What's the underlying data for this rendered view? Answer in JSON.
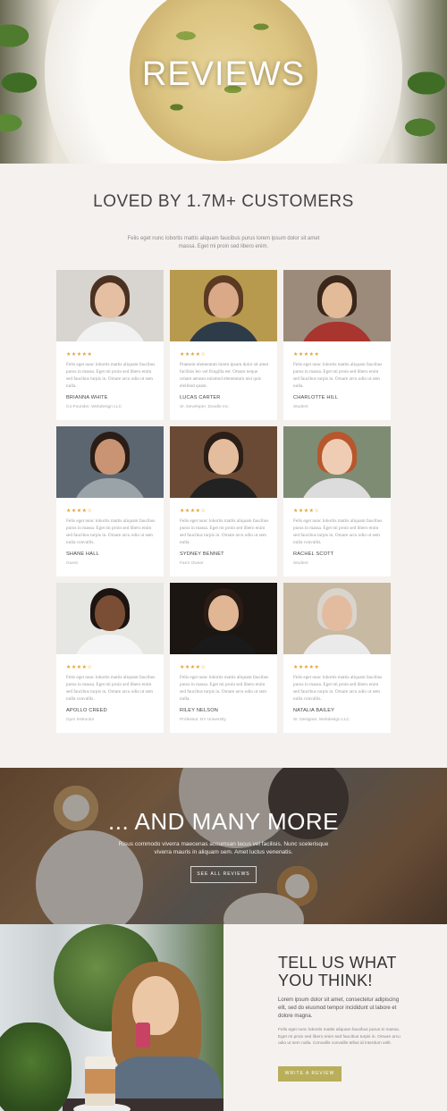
{
  "hero": {
    "title": "REVIEWS"
  },
  "intro": {
    "title": "LOVED BY 1.7M+ CUSTOMERS",
    "text": "Felis eget nunc lobortis mattis aliquam faucibus purus lorem ipsum dolor sit amet massa. Eget mi proin sed libero enim."
  },
  "reviews": [
    {
      "stars": "★★★★★",
      "quote": "Felis eget nunc lobortis mattis aliquam faucibus purus in massa. Eget mi proin sed libero enim sed faucibus turpis in. Ornare arcu odio ut sem nulla.",
      "name": "BRIANNA WHITE",
      "role": "Co-Founder, Webdesign LLC",
      "colors": {
        "bg": "#d8d4cf",
        "hair": "#4a3122",
        "skin": "#e5bfa2",
        "body": "#f1f1f1"
      }
    },
    {
      "stars": "★★★★☆",
      "quote": "Praesent elementum lorem ipsum dolor sit amet facilisis leo vel fringilla est. Ornare neque ornare aenean euismod elementum nisi quis eleifend quam.",
      "name": "LUCAS CARTER",
      "role": "Sr. Developer, Doodle Inc.",
      "colors": {
        "bg": "#b89a4e",
        "hair": "#5a3a22",
        "skin": "#d9a988",
        "body": "#2e3c4a"
      }
    },
    {
      "stars": "★★★★★",
      "quote": "Felis eget nunc lobortis mattis aliquam faucibus purus in massa. Eget mi proin sed libero enim sed faucibus turpis in. Ornare arcu odio ut sem nulla.",
      "name": "CHARLOTTE HILL",
      "role": "Student",
      "colors": {
        "bg": "#9c8b7a",
        "hair": "#3a261a",
        "skin": "#e3bb98",
        "body": "#a8352e"
      }
    },
    {
      "stars": "★★★★☆",
      "quote": "Felis eget nunc lobortis mattis aliquam faucibus purus in massa. Eget mi proin sed libero enim sed faucibus turpis in. Ornare arcu odio ut sem nulla convallis.",
      "name": "SHANE HALL",
      "role": "Guest",
      "colors": {
        "bg": "#5b6670",
        "hair": "#2a1d15",
        "skin": "#c89474",
        "body": "#9aa3a8"
      }
    },
    {
      "stars": "★★★★☆",
      "quote": "Felis eget nunc lobortis mattis aliquam faucibus purus in massa. Eget mi proin sed libero enim sed faucibus turpis in. Ornare arcu odio ut sem nulla.",
      "name": "SYDNEY BENNET",
      "role": "Farm Owner",
      "colors": {
        "bg": "#6a4a34",
        "hair": "#2b1e16",
        "skin": "#e4bd9e",
        "body": "#222222"
      }
    },
    {
      "stars": "★★★★☆",
      "quote": "Felis eget nunc lobortis mattis aliquam faucibus purus in massa. Eget mi proin sed libero enim sed faucibus turpis in. Ornare arcu odio ut sem nulla convallis.",
      "name": "RACHEL SCOTT",
      "role": "Student",
      "colors": {
        "bg": "#7f8c74",
        "hair": "#b8562c",
        "skin": "#efcdb4",
        "body": "#dcdcdc"
      }
    },
    {
      "stars": "★★★★☆",
      "quote": "Felis eget nunc lobortis mattis aliquam faucibus purus in massa. Eget mi proin sed libero enim sed faucibus turpis in. Ornare arcu odio ut sem nulla convallis.",
      "name": "APOLLO CREED",
      "role": "Gym Instructor",
      "colors": {
        "bg": "#e6e6e2",
        "hair": "#1c1410",
        "skin": "#7a4e35",
        "body": "#f4f4f4"
      }
    },
    {
      "stars": "★★★★☆",
      "quote": "Felis eget nunc lobortis mattis aliquam faucibus purus in massa. Eget mi proin sed libero enim sed faucibus turpis in. Ornare arcu odio ut sem nulla.",
      "name": "RILEY NELSON",
      "role": "Professor, NY University",
      "colors": {
        "bg": "#1b1612",
        "hair": "#2a1c14",
        "skin": "#e1b695",
        "body": "#1a1a1a"
      }
    },
    {
      "stars": "★★★★★",
      "quote": "Felis eget nunc lobortis mattis aliquam faucibus purus in massa. Eget mi proin sed libero enim sed faucibus turpis in. Ornare arcu odio ut sem nulla convallis.",
      "name": "NATALIA BAILEY",
      "role": "Sr. Designer, Webdesign LLC",
      "colors": {
        "bg": "#c8b9a2",
        "hair": "#d9d4cc",
        "skin": "#e3bca0",
        "body": "#eaeaea"
      }
    }
  ],
  "more": {
    "title": "... AND MANY MORE",
    "text": "Risus commodo viverra maecenas accumsan lacus vel facilisis. Nunc scelerisque viverra mauris in aliquam sem. Amet luctus venenatis.",
    "button": "SEE ALL REVIEWS"
  },
  "tell": {
    "title": "TELL US WHAT YOU THINK!",
    "lead": "Lorem ipsum dolor sit amet, consectetur adipiscing elit, sed do eiusmod tempor incididunt ut labore et dolore magna.",
    "body": "Felis eget nunc lobortis mattis aliquam faucibus purus in massa. Eget mi proin sed libero enim sed faucibus turpis in. Ornare arcu odio ut sem nulla. Convallis convallis tellus id interdum velit.",
    "button": "WRITE A REVIEW"
  },
  "colors": {
    "accent": "#b9ae5b",
    "star": "#e1a53a",
    "background": "#f4f1ee"
  }
}
